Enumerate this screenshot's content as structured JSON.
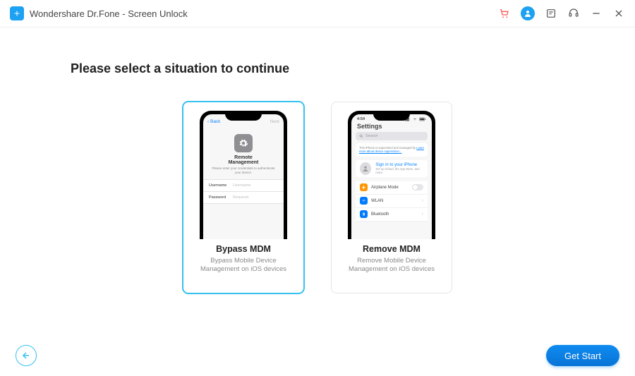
{
  "window_title": "Wondershare Dr.Fone - Screen Unlock",
  "heading": "Please select a situation to continue",
  "cards": {
    "bypass": {
      "title": "Bypass MDM",
      "desc": "Bypass Mobile Device Management on iOS devices",
      "screen": {
        "back": "Back",
        "next": "Next",
        "title1": "Remote",
        "title2": "Management",
        "sub": "Please enter your credentials to authenticate your device.",
        "fields": [
          {
            "label": "Username",
            "placeholder": "Username"
          },
          {
            "label": "Password",
            "placeholder": "Required"
          }
        ]
      }
    },
    "remove": {
      "title": "Remove MDM",
      "desc": "Remove Mobile Device Management on iOS devices",
      "screen": {
        "time": "4:54",
        "title": "Settings",
        "search": "Search",
        "banner_text": "This iPhone is supervised and managed by",
        "banner_link": "Learn more about device supervision...",
        "signin_title": "Sign in to your iPhone",
        "signin_sub": "Set up iCloud, the App Store, and more.",
        "rows": [
          {
            "label": "Airplane Mode",
            "color": "#ff9500"
          },
          {
            "label": "WLAN",
            "color": "#007aff"
          },
          {
            "label": "Bluetooth",
            "color": "#007aff"
          }
        ]
      }
    }
  },
  "footer": {
    "get_start": "Get Start"
  }
}
